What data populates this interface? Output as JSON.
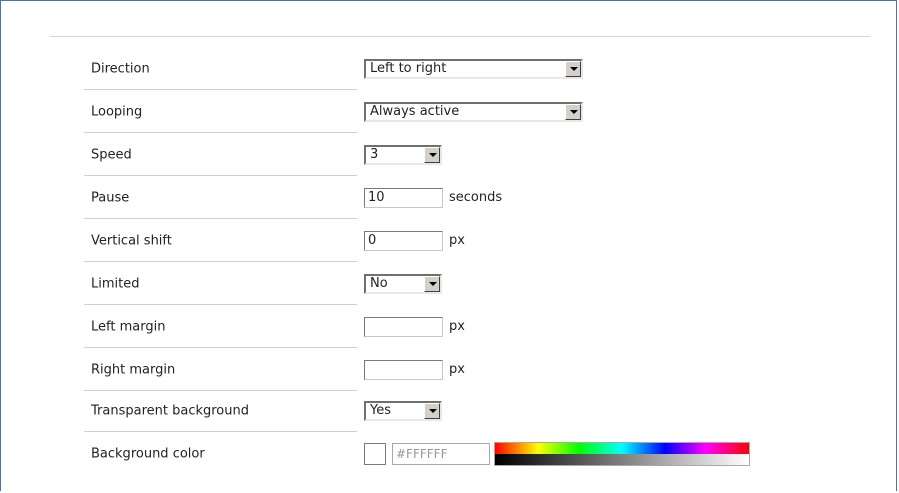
{
  "settings": [
    {
      "label": "Direction",
      "type": "select",
      "value": "Left to right"
    },
    {
      "label": "Looping",
      "type": "select",
      "value": "Always active"
    },
    {
      "label": "Speed",
      "type": "select",
      "value": "3"
    },
    {
      "label": "Pause",
      "type": "input",
      "value": "10",
      "unit": "seconds"
    },
    {
      "label": "Vertical shift",
      "type": "input",
      "value": "0",
      "unit": "px"
    },
    {
      "label": "Limited",
      "type": "select",
      "value": "No"
    },
    {
      "label": "Left margin",
      "type": "input",
      "value": "",
      "unit": "px"
    },
    {
      "label": "Right margin",
      "type": "input",
      "value": "",
      "unit": "px"
    },
    {
      "label": "Transparent background",
      "type": "select",
      "value": "Yes"
    },
    {
      "label": "Background color",
      "type": "color",
      "value": "#FFFFFF",
      "swatch_color": "#ffffff"
    }
  ],
  "colors": {
    "frame_border": "#4a6fb5",
    "separator": "#d0d0d0",
    "hex_text": "#999999"
  },
  "icons": {
    "dropdown_arrow": "chevron-down-icon",
    "color_palette": "color-palette-icon"
  }
}
